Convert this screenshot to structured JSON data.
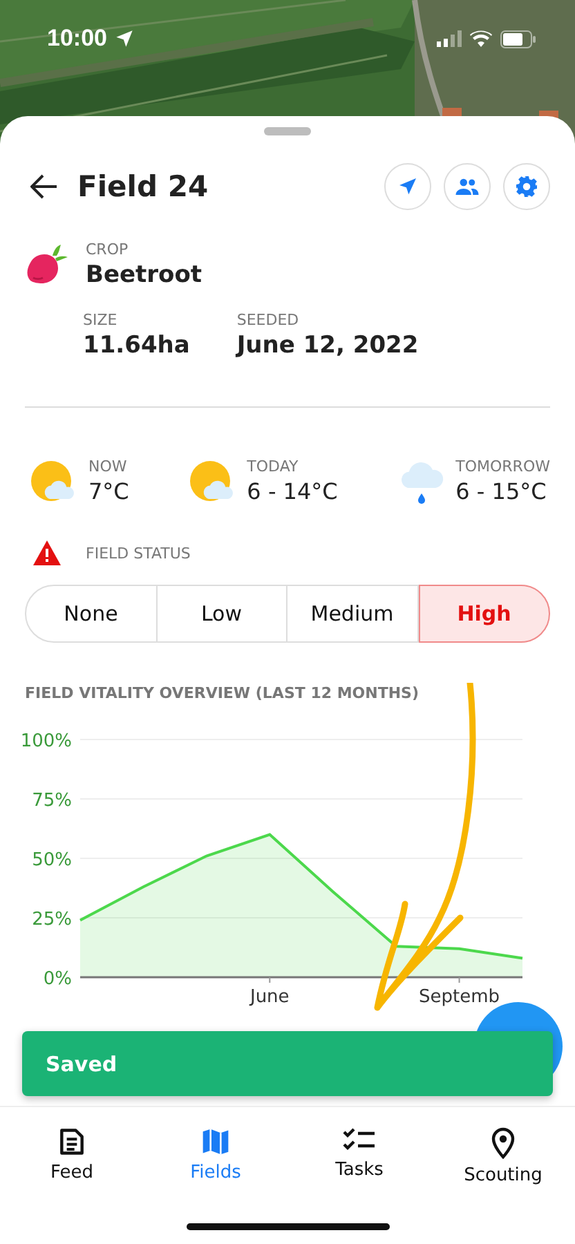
{
  "status_bar": {
    "time": "10:00"
  },
  "header": {
    "title": "Field 24",
    "actions": [
      {
        "kind": "locate"
      },
      {
        "kind": "people"
      },
      {
        "kind": "settings"
      }
    ]
  },
  "crop": {
    "label": "CROP",
    "value": "Beetroot"
  },
  "stats": [
    {
      "label": "SIZE",
      "value": "11.64ha"
    },
    {
      "label": "SEEDED",
      "value": "June 12, 2022"
    }
  ],
  "weather": [
    {
      "label": "NOW",
      "value": "7°C",
      "kind": "partly_cloudy"
    },
    {
      "label": "TODAY",
      "value": "6 - 14°C",
      "kind": "partly_cloudy"
    },
    {
      "label": "TOMORROW",
      "value": "6 - 15°C",
      "kind": "rain"
    }
  ],
  "field_status": {
    "label": "FIELD STATUS",
    "options": [
      {
        "label": "None",
        "selected": false
      },
      {
        "label": "Low",
        "selected": false
      },
      {
        "label": "Medium",
        "selected": false
      },
      {
        "label": "High",
        "selected": true
      }
    ]
  },
  "vitality": {
    "title": "FIELD VITALITY OVERVIEW (LAST 12 MONTHS)",
    "chart_data": {
      "type": "area",
      "categories": [
        null,
        null,
        null,
        "June",
        null,
        null,
        "Septemb",
        null
      ],
      "series": [
        {
          "color": "#4cd84c",
          "values": [
            24,
            38,
            51,
            60,
            36,
            13,
            12,
            8
          ]
        }
      ],
      "ylim": [
        0,
        100
      ],
      "grid": true,
      "yticks": [
        {
          "value": 0,
          "label": "0%"
        },
        {
          "value": 25,
          "label": "25%"
        },
        {
          "value": 50,
          "label": "50%"
        },
        {
          "value": 75,
          "label": "75%"
        },
        {
          "value": 100,
          "label": "100%"
        }
      ]
    }
  },
  "toast": {
    "message": "Saved"
  },
  "tab_bar": [
    {
      "label": "Feed",
      "kind": "feed",
      "selected": false
    },
    {
      "label": "Fields",
      "kind": "map",
      "selected": true
    },
    {
      "label": "Tasks",
      "kind": "tasks",
      "selected": false
    },
    {
      "label": "Scouting",
      "kind": "pin",
      "selected": false
    }
  ]
}
